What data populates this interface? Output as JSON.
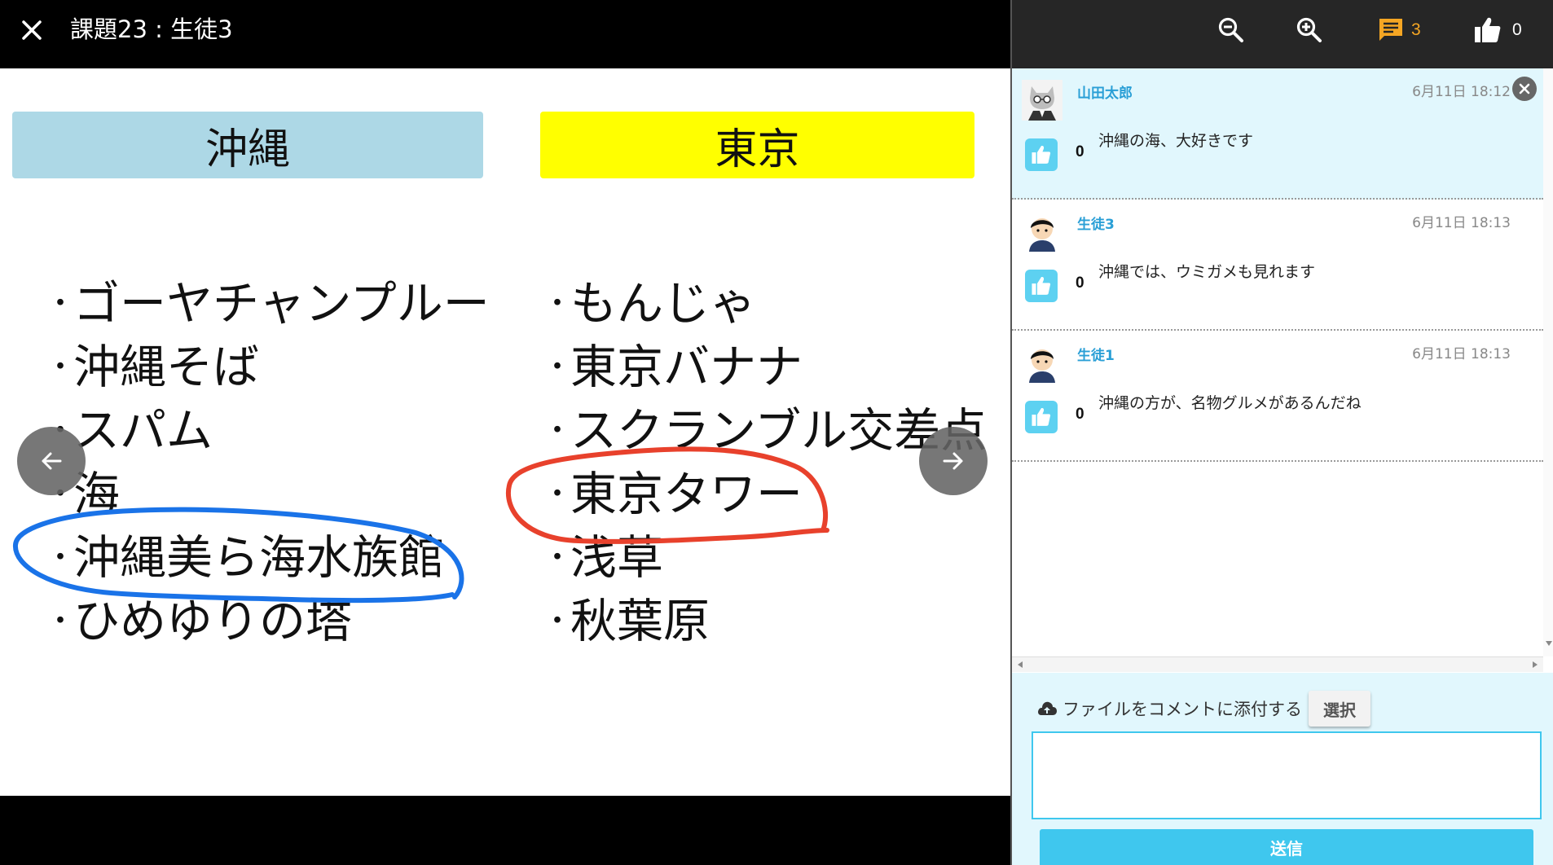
{
  "header": {
    "title": "課題23 : 生徒3"
  },
  "slide": {
    "left_heading": "沖縄",
    "right_heading": "東京",
    "left_items": [
      "ゴーヤチャンプルー",
      "沖縄そば",
      "スパム",
      "海",
      "沖縄美ら海水族館",
      "ひめゆりの塔"
    ],
    "right_items": [
      "もんじゃ",
      "東京バナナ",
      "スクランブル交差点",
      "東京タワー",
      "浅草",
      "秋葉原"
    ],
    "colors": {
      "left_heading_bg": "#add8e6",
      "right_heading_bg": "#ffff00",
      "blue_ink": "#1a73e8",
      "red_ink": "#e8412c"
    }
  },
  "panel": {
    "comments_count": "3",
    "likes_count": "0",
    "accent_color": "#3fc7ee",
    "comments": [
      {
        "author": "山田太郎",
        "time": "6月11日 18:12",
        "text": "沖縄の海、大好きです",
        "likes": "0",
        "avatar": "cat-avatar-icon"
      },
      {
        "author": "生徒3",
        "time": "6月11日 18:13",
        "text": "沖縄では、ウミガメも見れます",
        "likes": "0",
        "avatar": "student-avatar-icon"
      },
      {
        "author": "生徒1",
        "time": "6月11日 18:13",
        "text": "沖縄の方が、名物グルメがあるんだね",
        "likes": "0",
        "avatar": "student-avatar-icon"
      }
    ],
    "attach_label": "ファイルをコメントに添付する",
    "select_label": "選択",
    "input_value": "",
    "send_label": "送信"
  }
}
